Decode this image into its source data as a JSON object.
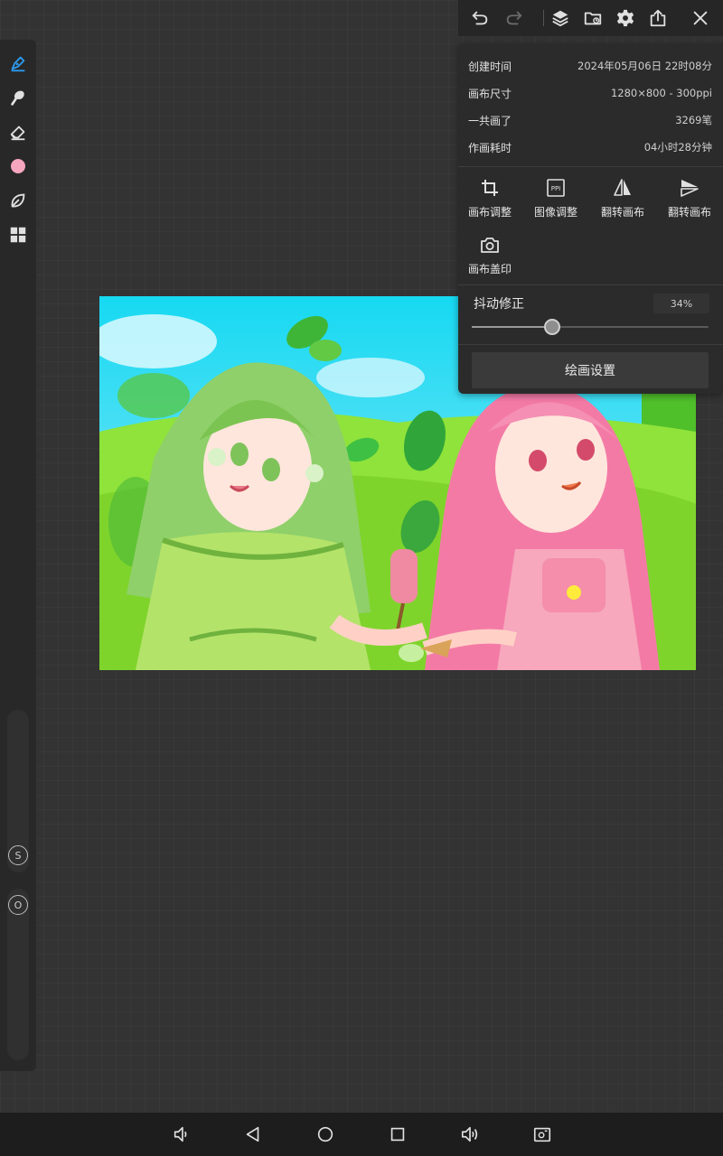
{
  "top_bar": {
    "icons": [
      "undo-icon",
      "redo-icon",
      "layers-icon",
      "folder-icon",
      "gear-icon",
      "share-icon",
      "close-icon"
    ]
  },
  "left_toolbar": {
    "tools": [
      "brush-icon",
      "smudge-icon",
      "eraser-icon",
      "color-swatch",
      "leaf-icon",
      "grid-icon"
    ],
    "active_color": "#f6a6bf",
    "accent": "#2c9bf0",
    "size_slider_label": "S",
    "opacity_slider_label": "O"
  },
  "info": {
    "rows": [
      {
        "label": "创建时间",
        "value": "2024年05月06日 22时08分"
      },
      {
        "label": "画布尺寸",
        "value": "1280×800 - 300ppi"
      },
      {
        "label": "一共画了",
        "value": "3269笔"
      },
      {
        "label": "作画耗时",
        "value": "04小时28分钟"
      }
    ]
  },
  "actions": [
    {
      "label": "画布调整",
      "icon": "crop-icon"
    },
    {
      "label": "图像调整",
      "icon": "ppi-icon",
      "icon_text": "PPI"
    },
    {
      "label": "翻转画布",
      "icon": "flip-horizontal-icon"
    },
    {
      "label": "翻转画布",
      "icon": "flip-vertical-icon"
    },
    {
      "label": "画布盖印",
      "icon": "camera-icon"
    }
  ],
  "stabilizer": {
    "label": "抖动修正",
    "value_text": "34%",
    "value": 0.34
  },
  "settings_button": "绘画设置",
  "nav_bar": {
    "icons": [
      "volume-down-icon",
      "back-icon",
      "home-icon",
      "recents-icon",
      "volume-up-icon",
      "screenshot-icon"
    ]
  }
}
